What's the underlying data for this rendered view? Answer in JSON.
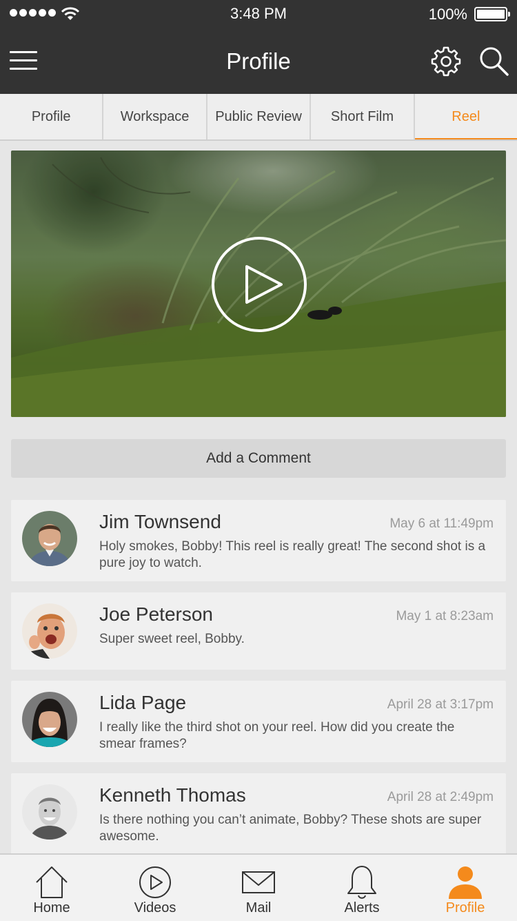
{
  "status_bar": {
    "time": "3:48 PM",
    "battery": "100%"
  },
  "nav": {
    "title": "Profile"
  },
  "tabs": [
    {
      "label": "Profile",
      "active": false
    },
    {
      "label": "Workspace",
      "active": false
    },
    {
      "label": "Public Review",
      "active": false
    },
    {
      "label": "Short Film",
      "active": false
    },
    {
      "label": "Reel",
      "active": true
    }
  ],
  "add_comment_label": "Add a Comment",
  "comments": [
    {
      "name": "Jim Townsend",
      "date": "May 6 at 11:49pm",
      "text": "Holy smokes, Bobby! This reel is really great! The second shot is a pure joy to watch."
    },
    {
      "name": "Joe Peterson",
      "date": "May 1 at 8:23am",
      "text": "Super sweet reel, Bobby."
    },
    {
      "name": "Lida Page",
      "date": "April 28 at 3:17pm",
      "text": "I really like the third shot on your reel. How did you create the smear frames?"
    },
    {
      "name": "Kenneth Thomas",
      "date": "April 28 at 2:49pm",
      "text": "Is there nothing you can’t animate, Bobby? These shots are super awesome."
    }
  ],
  "tab_bar": [
    {
      "label": "Home",
      "icon": "home-icon",
      "active": false
    },
    {
      "label": "Videos",
      "icon": "play-circle-icon",
      "active": false
    },
    {
      "label": "Mail",
      "icon": "mail-icon",
      "active": false
    },
    {
      "label": "Alerts",
      "icon": "bell-icon",
      "active": false
    },
    {
      "label": "Profile",
      "icon": "person-icon",
      "active": true
    }
  ],
  "colors": {
    "accent": "#f48a1c",
    "header": "#333333",
    "background": "#e6e6e6"
  }
}
